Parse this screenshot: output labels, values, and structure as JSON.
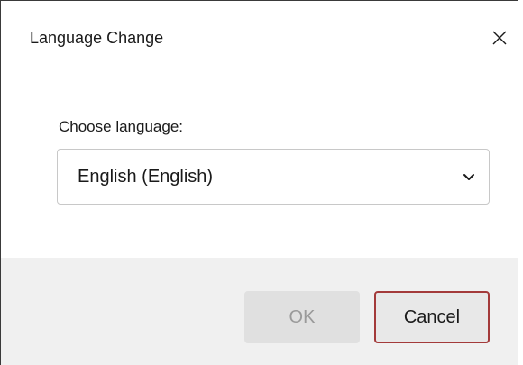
{
  "dialog": {
    "title": "Language Change",
    "close_icon": "close-icon"
  },
  "content": {
    "label": "Choose language:",
    "select": {
      "selected": "English (English)",
      "chevron_icon": "chevron-down-icon"
    }
  },
  "footer": {
    "ok_label": "OK",
    "cancel_label": "Cancel",
    "ok_disabled": true
  },
  "colors": {
    "footer_bg": "#f0f0f0",
    "cancel_border": "#a33a3a",
    "disabled_text": "#9a9a9a"
  }
}
